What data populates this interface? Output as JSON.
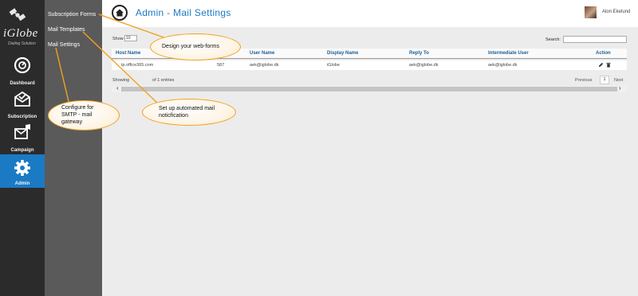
{
  "brand": {
    "name": "iGlobe",
    "tagline": "Dialing Solution"
  },
  "rail": [
    {
      "label": "Dashboard",
      "icon": "dashboard-icon"
    },
    {
      "label": "Subscription",
      "icon": "subscription-icon"
    },
    {
      "label": "Campaign",
      "icon": "campaign-icon"
    },
    {
      "label": "Admin",
      "icon": "gear-icon",
      "active": true
    }
  ],
  "menu": [
    "Subscription Forms",
    "Mail Templates",
    "Mail Settings"
  ],
  "header": {
    "title": "Admin - Mail Settings",
    "user": "Alon Ekelund"
  },
  "table": {
    "show_label": "Show",
    "show_value": "10",
    "search_label": "Search:",
    "columns": [
      "Host Name",
      "User Name",
      "Display Name",
      "Reply To",
      "Intermediate User",
      "Action"
    ],
    "rows": [
      {
        "host": "tp.office365.com",
        "port": "587",
        "user": "aek@iglobe.dk",
        "display": "iGlobe",
        "reply": "aek@iglobe.dk",
        "intermediate": "aek@iglobe.dk"
      }
    ],
    "info_prefix": "Showing",
    "info_suffix": "of 1 entries",
    "pagination": {
      "prev": "Previous",
      "current": "1",
      "next": "Next"
    }
  },
  "callouts": {
    "forms": "Design your web-forms",
    "templates_1": "Set up automated mail",
    "templates_2": "noticfication",
    "settings_1": "Configure for",
    "settings_2": "SMTP - mail",
    "settings_3": "gateway"
  },
  "colors": {
    "accent": "#1b7ac4",
    "rail": "#2b2b2b",
    "menu": "#5a5a5a",
    "callout_border": "#f0a21e"
  }
}
